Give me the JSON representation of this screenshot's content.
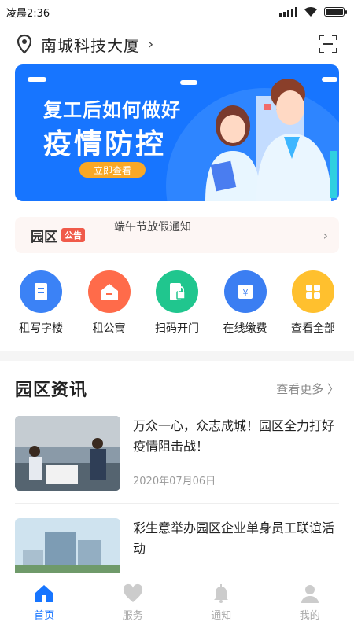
{
  "status": {
    "time": "凌晨2:36"
  },
  "location": {
    "name": "南城科技大厦",
    "chevron": "›"
  },
  "banner": {
    "line1": "复工后如何做好",
    "line2": "疫情防控",
    "button": "立即查看"
  },
  "notice": {
    "logo_text": "园区",
    "tag": "公告",
    "text": "端午节放假通知"
  },
  "quick": [
    {
      "label": "租写字楼",
      "icon": "office-icon",
      "color": "#3b82f6"
    },
    {
      "label": "租公寓",
      "icon": "house-icon",
      "color": "#ff6b4a"
    },
    {
      "label": "扫码开门",
      "icon": "scan-door-icon",
      "color": "#20c68e"
    },
    {
      "label": "在线缴费",
      "icon": "payment-icon",
      "color": "#3b7ef2"
    },
    {
      "label": "查看全部",
      "icon": "grid-icon",
      "color": "#ffc02e"
    }
  ],
  "news": {
    "title": "园区资讯",
    "more": "查看更多 〉",
    "items": [
      {
        "title": "万众一心，众志成城！园区全力打好疫情阻击战！",
        "date": "2020年07月06日"
      },
      {
        "title": "彩生意举办园区企业单身员工联谊活动",
        "date": ""
      }
    ]
  },
  "tabs": [
    {
      "label": "首页",
      "icon": "home-icon",
      "active": true
    },
    {
      "label": "服务",
      "icon": "heart-icon",
      "active": false
    },
    {
      "label": "通知",
      "icon": "bell-icon",
      "active": false
    },
    {
      "label": "我的",
      "icon": "profile-icon",
      "active": false
    }
  ],
  "colors": {
    "accent": "#1775ff",
    "banner": "#1775ff",
    "inactive": "#cccccc"
  }
}
